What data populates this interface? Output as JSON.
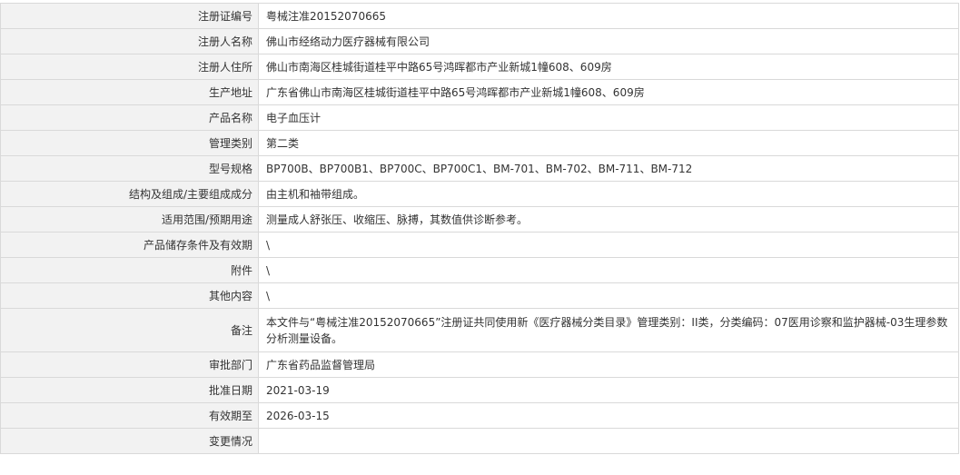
{
  "rows": [
    {
      "label": "注册证编号",
      "value": "粤械注准20152070665"
    },
    {
      "label": "注册人名称",
      "value": "佛山市经络动力医疗器械有限公司"
    },
    {
      "label": "注册人住所",
      "value": "佛山市南海区桂城街道桂平中路65号鸿晖都市产业新城1幢608、609房"
    },
    {
      "label": "生产地址",
      "value": "广东省佛山市南海区桂城街道桂平中路65号鸿晖都市产业新城1幢608、609房"
    },
    {
      "label": "产品名称",
      "value": "电子血压计"
    },
    {
      "label": "管理类别",
      "value": "第二类"
    },
    {
      "label": "型号规格",
      "value": "BP700B、BP700B1、BP700C、BP700C1、BM-701、BM-702、BM-711、BM-712"
    },
    {
      "label": "结构及组成/主要组成成分",
      "value": "由主机和袖带组成。"
    },
    {
      "label": "适用范围/预期用途",
      "value": "测量成人舒张压、收缩压、脉搏，其数值供诊断参考。"
    },
    {
      "label": "产品储存条件及有效期",
      "value": "\\"
    },
    {
      "label": "附件",
      "value": "\\"
    },
    {
      "label": "其他内容",
      "value": "\\"
    },
    {
      "label": "备注",
      "value": "本文件与“粤械注准20152070665”注册证共同使用新《医疗器械分类目录》管理类别：II类，分类编码：07医用诊察和监护器械-03生理参数分析测量设备。"
    },
    {
      "label": "审批部门",
      "value": "广东省药品监督管理局"
    },
    {
      "label": "批准日期",
      "value": "2021-03-19"
    },
    {
      "label": "有效期至",
      "value": "2026-03-15"
    },
    {
      "label": "变更情况",
      "value": ""
    }
  ]
}
